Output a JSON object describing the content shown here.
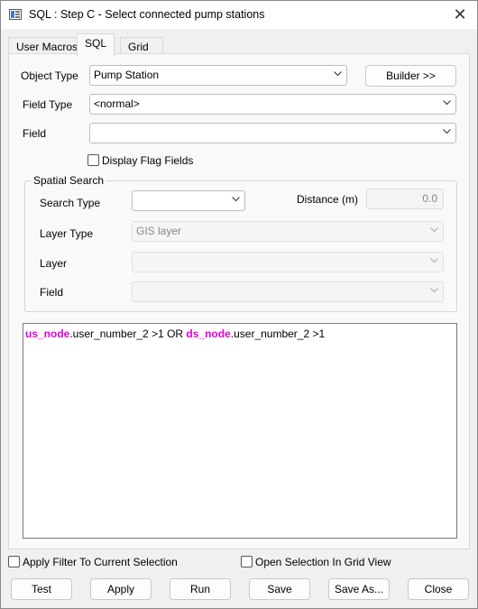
{
  "window": {
    "title": "SQL : Step C - Select connected pump stations",
    "close_glyph": "✕"
  },
  "tabs": [
    {
      "label": "User Macros",
      "active": false
    },
    {
      "label": "SQL",
      "active": true
    },
    {
      "label": "Grid",
      "active": false
    }
  ],
  "form": {
    "object_type_label": "Object Type",
    "object_type_value": "Pump Station",
    "builder_label": "Builder >>",
    "field_type_label": "Field Type",
    "field_type_value": "<normal>",
    "field_label": "Field",
    "field_value": "",
    "display_flag_fields_label": "Display Flag Fields",
    "display_flag_fields_checked": false
  },
  "spatial_search": {
    "title": "Spatial Search",
    "search_type_label": "Search Type",
    "search_type_value": "",
    "distance_label": "Distance (m)",
    "distance_value": "0.0",
    "layer_type_label": "Layer Type",
    "layer_type_value": "GIS layer",
    "layer_label": "Layer",
    "layer_value": "",
    "field_label": "Field",
    "field_value": ""
  },
  "sql": {
    "part1_kw": "us_node",
    "part1_rest": ".user_number_2 >1 OR ",
    "part2_kw": "ds_node",
    "part2_rest": ".user_number_2 >1"
  },
  "options": {
    "apply_filter_label": "Apply Filter To Current Selection",
    "apply_filter_checked": false,
    "open_grid_label": "Open Selection In Grid View",
    "open_grid_checked": false
  },
  "buttons": {
    "test": "Test",
    "apply": "Apply",
    "run": "Run",
    "save": "Save",
    "save_as": "Save As...",
    "close": "Close"
  },
  "colors": {
    "keyword": "#e100e1",
    "dialog_bg": "#f0f0f0"
  },
  "icons": [
    "app-icon",
    "close-icon",
    "chevron-down-icon"
  ]
}
